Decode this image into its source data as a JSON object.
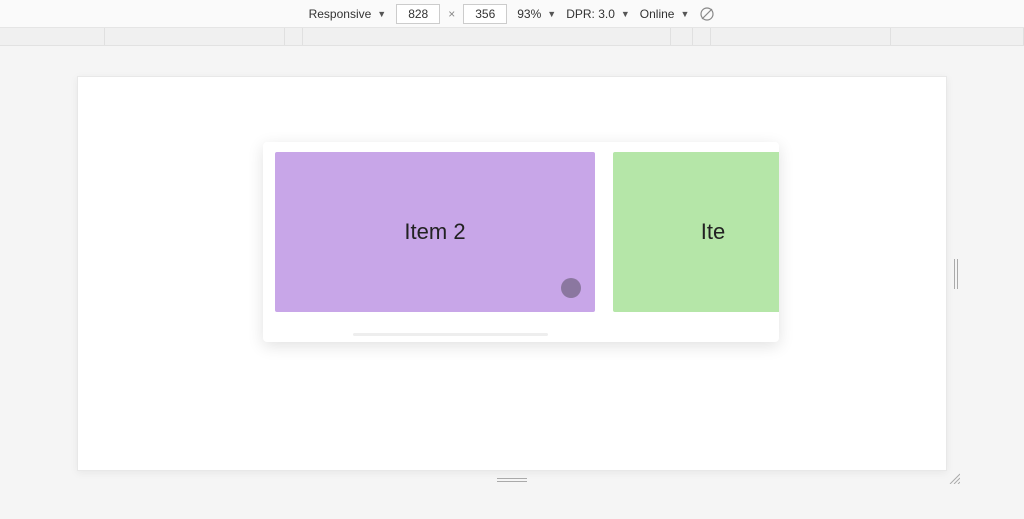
{
  "toolbar": {
    "device_mode_label": "Responsive",
    "width": "828",
    "height": "356",
    "zoom_label": "93%",
    "dpr_label": "DPR: 3.0",
    "network_label": "Online"
  },
  "carousel": {
    "items": [
      {
        "label": "Item 2",
        "color": "#c8a6e8"
      },
      {
        "label": "Ite",
        "color": "#b5e6a8"
      }
    ]
  }
}
